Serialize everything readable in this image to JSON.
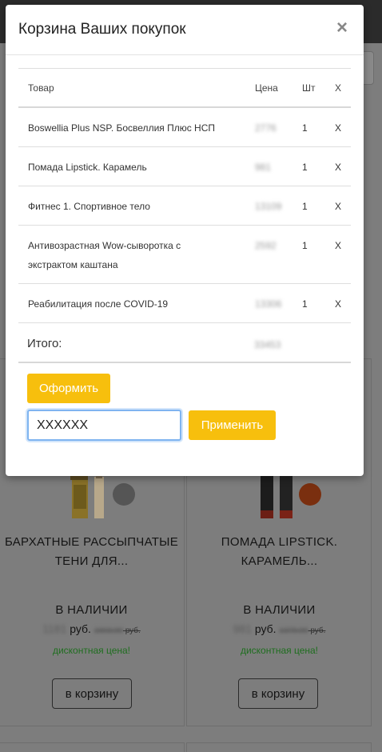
{
  "modal": {
    "title": "Корзина Ваших покупок",
    "close_symbol": "×",
    "table": {
      "headers": {
        "product": "Товар",
        "price": "Цена",
        "qty": "Шт",
        "remove": "X"
      },
      "rows": [
        {
          "name": "Boswellia Plus NSP. Босвеллия Плюс НСП",
          "price": "2776",
          "qty": "1",
          "remove": "X"
        },
        {
          "name": "Помада Lipstick. Карамель",
          "price": "981",
          "qty": "1",
          "remove": "X"
        },
        {
          "name": "Фитнес 1. Спортивное тело",
          "price": "13109",
          "qty": "1",
          "remove": "X"
        },
        {
          "name_line1": "Антивозрастная Wow-сыворотка с",
          "name_line2": "экстрактом каштана",
          "price": "2592",
          "qty": "1",
          "remove": "X"
        },
        {
          "name": "Реабилитация после COVID-19",
          "price": "13306",
          "qty": "1",
          "remove": "X"
        }
      ],
      "total_label": "Итого:",
      "total_value": "33453"
    },
    "checkout_label": "Оформить",
    "promo": {
      "value": "XXXXXX"
    },
    "apply_label": "Применить"
  },
  "background": {
    "products": [
      {
        "name_line1": "БАРХАТНЫЕ РАССЫПЧАТЫЕ",
        "name_line2": "ТЕНИ ДЛЯ...",
        "stock": "В НАЛИЧИИ",
        "price": "1181",
        "currency": "руб.",
        "old_price": "1603.00",
        "old_currency": "руб.",
        "discount_text": "дисконтная цена!",
        "cart_label": "в корзину",
        "swatch_color": "#555555"
      },
      {
        "name_line1": "ПОМАДА LIPSTICK.",
        "name_line2": "КАРАМЕЛЬ...",
        "stock": "В НАЛИЧИИ",
        "price": "981",
        "currency": "руб.",
        "old_price": "1379.00",
        "old_currency": "руб.",
        "discount_text": "дисконтная цена!",
        "cart_label": "в корзину",
        "swatch_color": "#7a2f0f"
      }
    ]
  },
  "colors": {
    "accent": "#f7bf0d",
    "overlay": "#7d7d7d",
    "discount": "#1f6e1f"
  }
}
